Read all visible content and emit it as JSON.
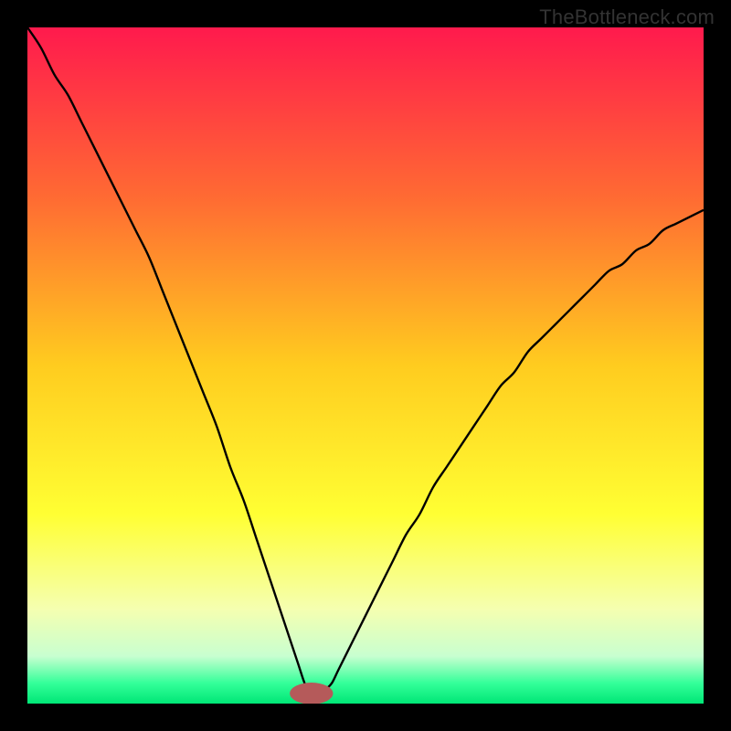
{
  "attribution": "TheBottleneck.com",
  "colors": {
    "background": "#000000",
    "curve_stroke": "#000000",
    "marker_fill": "#b55a5a",
    "gradient_stops": [
      {
        "offset": 0.0,
        "color": "#ff1a4d"
      },
      {
        "offset": 0.25,
        "color": "#ff6a33"
      },
      {
        "offset": 0.5,
        "color": "#ffcc1f"
      },
      {
        "offset": 0.72,
        "color": "#ffff33"
      },
      {
        "offset": 0.86,
        "color": "#f5ffb0"
      },
      {
        "offset": 0.93,
        "color": "#c8ffd0"
      },
      {
        "offset": 0.97,
        "color": "#33ff99"
      },
      {
        "offset": 1.0,
        "color": "#00e676"
      }
    ]
  },
  "chart_data": {
    "type": "line",
    "title": "",
    "xlabel": "",
    "ylabel": "",
    "xlim": [
      0,
      100
    ],
    "ylim": [
      0,
      100
    ],
    "optimum_x": 42,
    "marker": {
      "x": 42,
      "y": 1.5,
      "rx": 3.2,
      "ry": 1.6
    },
    "series": [
      {
        "name": "curve",
        "x": [
          0,
          2,
          4,
          6,
          8,
          10,
          12,
          14,
          16,
          18,
          20,
          22,
          24,
          26,
          28,
          30,
          32,
          34,
          36,
          38,
          40,
          41,
          42,
          43,
          44,
          45,
          46,
          48,
          50,
          52,
          54,
          56,
          58,
          60,
          62,
          64,
          66,
          68,
          70,
          72,
          74,
          76,
          78,
          80,
          82,
          84,
          86,
          88,
          90,
          92,
          94,
          96,
          98,
          100
        ],
        "values": [
          100,
          97,
          93,
          90,
          86,
          82,
          78,
          74,
          70,
          66,
          61,
          56,
          51,
          46,
          41,
          35,
          30,
          24,
          18,
          12,
          6,
          3,
          1,
          1,
          2,
          3,
          5,
          9,
          13,
          17,
          21,
          25,
          28,
          32,
          35,
          38,
          41,
          44,
          47,
          49,
          52,
          54,
          56,
          58,
          60,
          62,
          64,
          65,
          67,
          68,
          70,
          71,
          72,
          73
        ]
      }
    ]
  }
}
